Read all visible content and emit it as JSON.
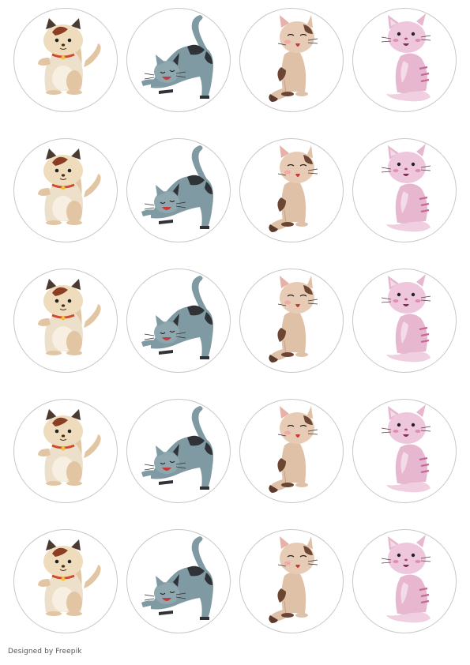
{
  "sheet": {
    "grid": {
      "rows": 5,
      "columns": 4
    },
    "columns": [
      {
        "sticker": "cream-cat-waving",
        "icon": "cream-cat-waving-icon"
      },
      {
        "sticker": "gray-cat-stretching",
        "icon": "gray-cat-stretching-icon"
      },
      {
        "sticker": "tan-cat-sitting-eyes-closed",
        "icon": "tan-cat-sitting-icon"
      },
      {
        "sticker": "pink-cat-sitting",
        "icon": "pink-cat-sitting-icon"
      }
    ],
    "colors": {
      "circle_border": "#c8c8c8",
      "cream_cat": "#efdcbc",
      "gray_cat": "#7f9aa3",
      "tan_cat": "#dfc1a8",
      "pink_cat": "#e6b7cf"
    }
  },
  "footer": {
    "credit": "Designed by Freepik"
  }
}
